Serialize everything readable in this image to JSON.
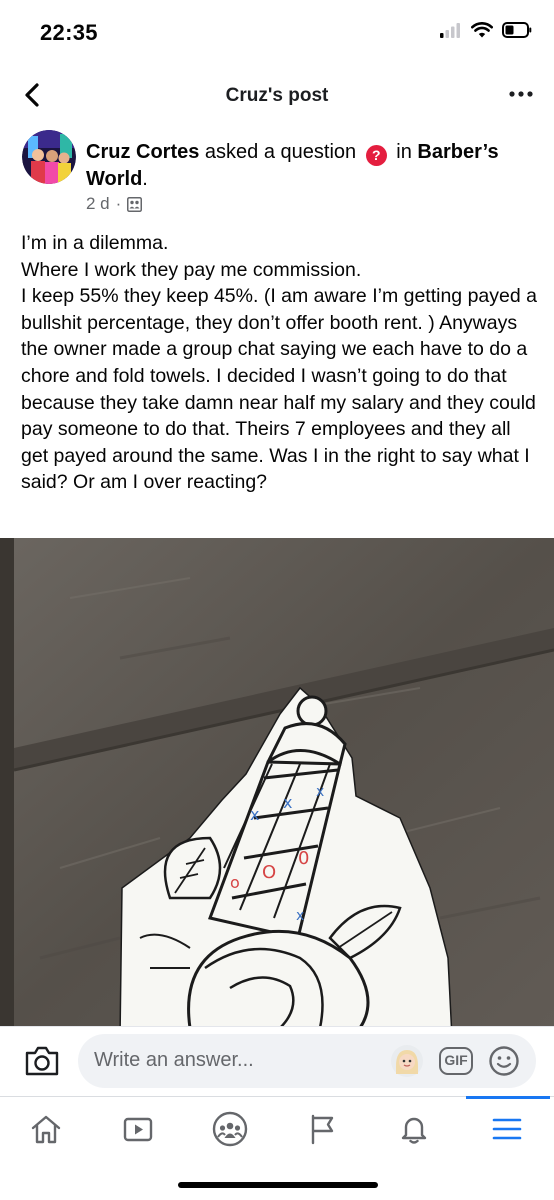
{
  "status_bar": {
    "time": "22:35",
    "icons": [
      "cellular-signal-icon",
      "wifi-icon",
      "battery-icon"
    ]
  },
  "header": {
    "title": "Cruz's post",
    "back_icon": "chevron-left-icon",
    "more_icon": "more-horizontal-icon"
  },
  "post": {
    "author": "Cruz Cortes",
    "action": "asked a question",
    "in_word": "in",
    "group": "Barber’s World",
    "time": "2 d",
    "separator": "·",
    "privacy_icon": "group-members-icon",
    "body": [
      "I’m in a dilemma.",
      "Where I work they pay me commission.",
      "I keep 55% they keep 45%. (I am aware I’m getting payed a bullshit percentage, they don’t offer booth rent. ) Anyways the owner made a group chat saying we each have to do a chore and fold towels. I decided I wasn’t going to do that because they take damn near half my salary and they could pay someone to do that. Theirs 7 employees and they all get payed around the same. Was I in the right to say what I said? Or am I over reacting?"
    ],
    "photo": {
      "subject": "barber-pole-tattoo-flash-icon",
      "colors": {
        "wall": "#5d5852",
        "paper": "#f7f7f3",
        "ink": "#1b1b1b",
        "blue_mark": "#3d73c4",
        "red_mark": "#d64545"
      }
    }
  },
  "comment_bar": {
    "placeholder": "Write an answer...",
    "gif_label": "GIF",
    "icons": [
      "camera-icon",
      "avatar-sticker-icon",
      "gif-icon",
      "emoji-icon"
    ]
  },
  "bottom_nav": {
    "items": [
      "home-icon",
      "watch-icon",
      "groups-icon",
      "pages-flag-icon",
      "notifications-bell-icon",
      "menu-icon"
    ],
    "active": "menu-icon",
    "accent": "#1877f2"
  }
}
